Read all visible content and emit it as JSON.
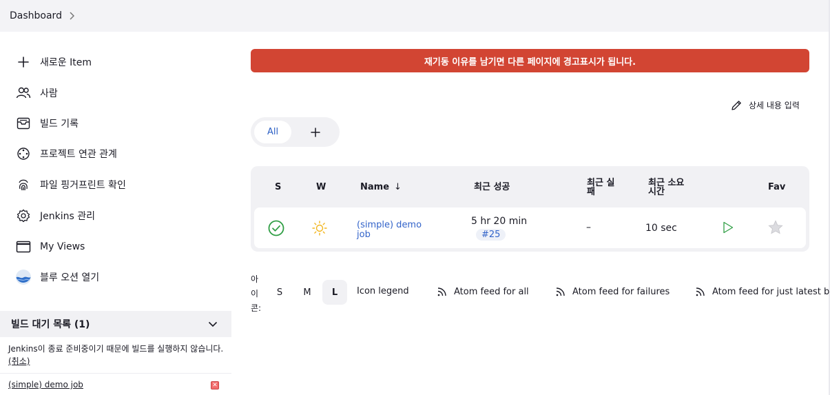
{
  "breadcrumb": {
    "dashboard": "Dashboard"
  },
  "sidebar": {
    "tasks": [
      {
        "label": "새로운 Item",
        "icon": "plus-icon"
      },
      {
        "label": "사람",
        "icon": "people-icon"
      },
      {
        "label": "빌드 기록",
        "icon": "build-history-icon"
      },
      {
        "label": "프로젝트 연관 관계",
        "icon": "project-relationship-icon"
      },
      {
        "label": "파일 핑거프린트 확인",
        "icon": "fingerprint-icon"
      },
      {
        "label": "Jenkins 관리",
        "icon": "gear-icon"
      },
      {
        "label": "My Views",
        "icon": "window-icon"
      },
      {
        "label": "블루 오션 열기",
        "icon": "blue-ocean-icon"
      }
    ],
    "queue": {
      "title": "빌드 대기 목록 (1)",
      "message": "Jenkins이 종료 준비중이기 때문에 빌드를 실행하지 않습니다.",
      "cancel": "(취소)",
      "item": "(simple) demo job"
    }
  },
  "main": {
    "alert": "재기동 이유를 남기면 다른 페이지에 경고표시가 됩니다.",
    "edit_description": "상세 내용 입력",
    "tabs": {
      "all": "All",
      "add": "+"
    },
    "table": {
      "headers": {
        "s": "S",
        "w": "W",
        "name": "Name",
        "name_sort": "↓",
        "last_success": "최근 성공",
        "last_failure": "최근 실패",
        "last_duration": "최근 소요 시간",
        "fav": "Fav"
      },
      "rows": [
        {
          "status": "success",
          "weather": "sunny",
          "name": "(simple) demo job",
          "last_success": "5 hr 20 min",
          "build": "#25",
          "last_failure": "–",
          "duration": "10 sec"
        }
      ]
    },
    "legend": {
      "icon_label": "아이콘:",
      "sizes": [
        "S",
        "M",
        "L"
      ],
      "selected_size": "L",
      "icon_legend": "Icon legend",
      "feeds": [
        "Atom feed for all",
        "Atom feed for failures",
        "Atom feed for just latest builds"
      ]
    }
  },
  "colors": {
    "alert": "#d24533",
    "link": "#3263c9",
    "success": "#2f9e44",
    "sunny": "#f2b51d",
    "panel": "#f1f1f4"
  }
}
